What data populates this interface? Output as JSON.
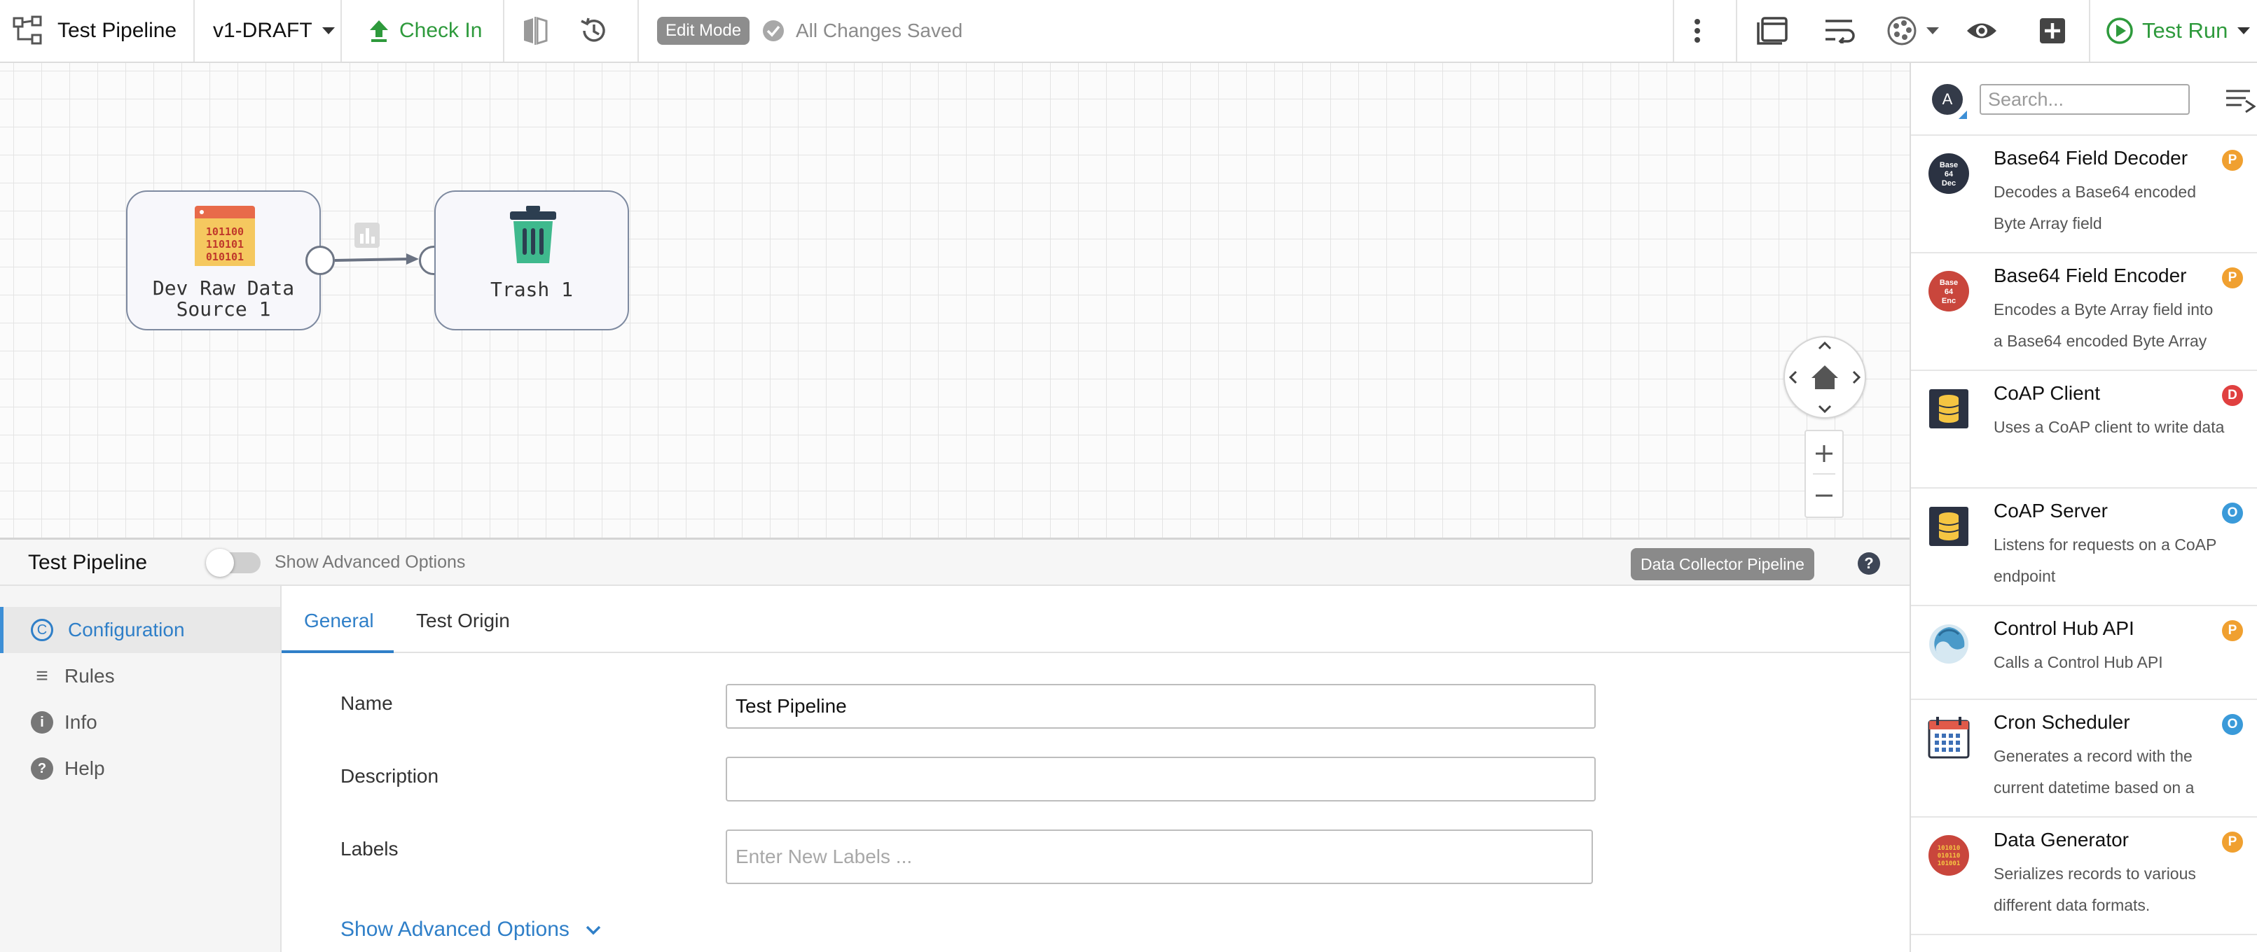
{
  "toolbar": {
    "pipeline_title": "Test Pipeline",
    "version": "v1-DRAFT",
    "check_in": "Check In",
    "mode_badge": "Edit Mode",
    "save_status": "All Changes Saved",
    "test_run": "Test Run"
  },
  "canvas": {
    "stages": [
      {
        "label_line1": "Dev Raw Data",
        "label_line2": "Source 1",
        "icon": "binary-data-icon"
      },
      {
        "label_line1": "Trash 1",
        "icon": "trash-icon"
      }
    ]
  },
  "library": {
    "avatar_letter": "A",
    "search_placeholder": "Search...",
    "items": [
      {
        "name": "Base64 Field Decoder",
        "desc": "Decodes a Base64 encoded Byte Array field",
        "badge": "P",
        "badge_color": "#f0a030",
        "icon_text": "Base\n64\nDec",
        "icon_color": "#2b3242"
      },
      {
        "name": "Base64 Field Encoder",
        "desc": "Encodes a Byte Array field into a Base64 encoded Byte Array",
        "badge": "P",
        "badge_color": "#f0a030",
        "icon_text": "Base\n64\nEnc",
        "icon_color": "#c9463c"
      },
      {
        "name": "CoAP Client",
        "desc": "Uses a CoAP client to write data",
        "badge": "D",
        "badge_color": "#e04040",
        "icon": "database-icon"
      },
      {
        "name": "CoAP Server",
        "desc": "Listens for requests on a CoAP endpoint",
        "badge": "O",
        "badge_color": "#3a9ad9",
        "icon": "database-icon"
      },
      {
        "name": "Control Hub API",
        "desc": "Calls a Control Hub API",
        "badge": "P",
        "badge_color": "#f0a030",
        "icon": "api-swirl-icon"
      },
      {
        "name": "Cron Scheduler",
        "desc": "Generates a record with the current datetime based on a",
        "badge": "O",
        "badge_color": "#3a9ad9",
        "icon": "calendar-icon"
      },
      {
        "name": "Data Generator",
        "desc": "Serializes records to various different data formats.",
        "badge": "P",
        "badge_color": "#f0a030",
        "icon": "binary-circle-icon"
      }
    ]
  },
  "config": {
    "title": "Test Pipeline",
    "advanced_toggle_label": "Show Advanced Options",
    "pipeline_type": "Data Collector Pipeline",
    "help_glyph": "?",
    "nav": [
      {
        "label": "Configuration",
        "glyph": "C"
      },
      {
        "label": "Rules",
        "glyph": "≡"
      },
      {
        "label": "Info",
        "glyph": "i"
      },
      {
        "label": "Help",
        "glyph": "?"
      }
    ],
    "tabs": [
      "General",
      "Test Origin"
    ],
    "fields": {
      "name_label": "Name",
      "name_value": "Test Pipeline",
      "description_label": "Description",
      "description_value": "",
      "labels_label": "Labels",
      "labels_placeholder": "Enter New Labels ..."
    },
    "show_advanced_link": "Show Advanced Options"
  }
}
